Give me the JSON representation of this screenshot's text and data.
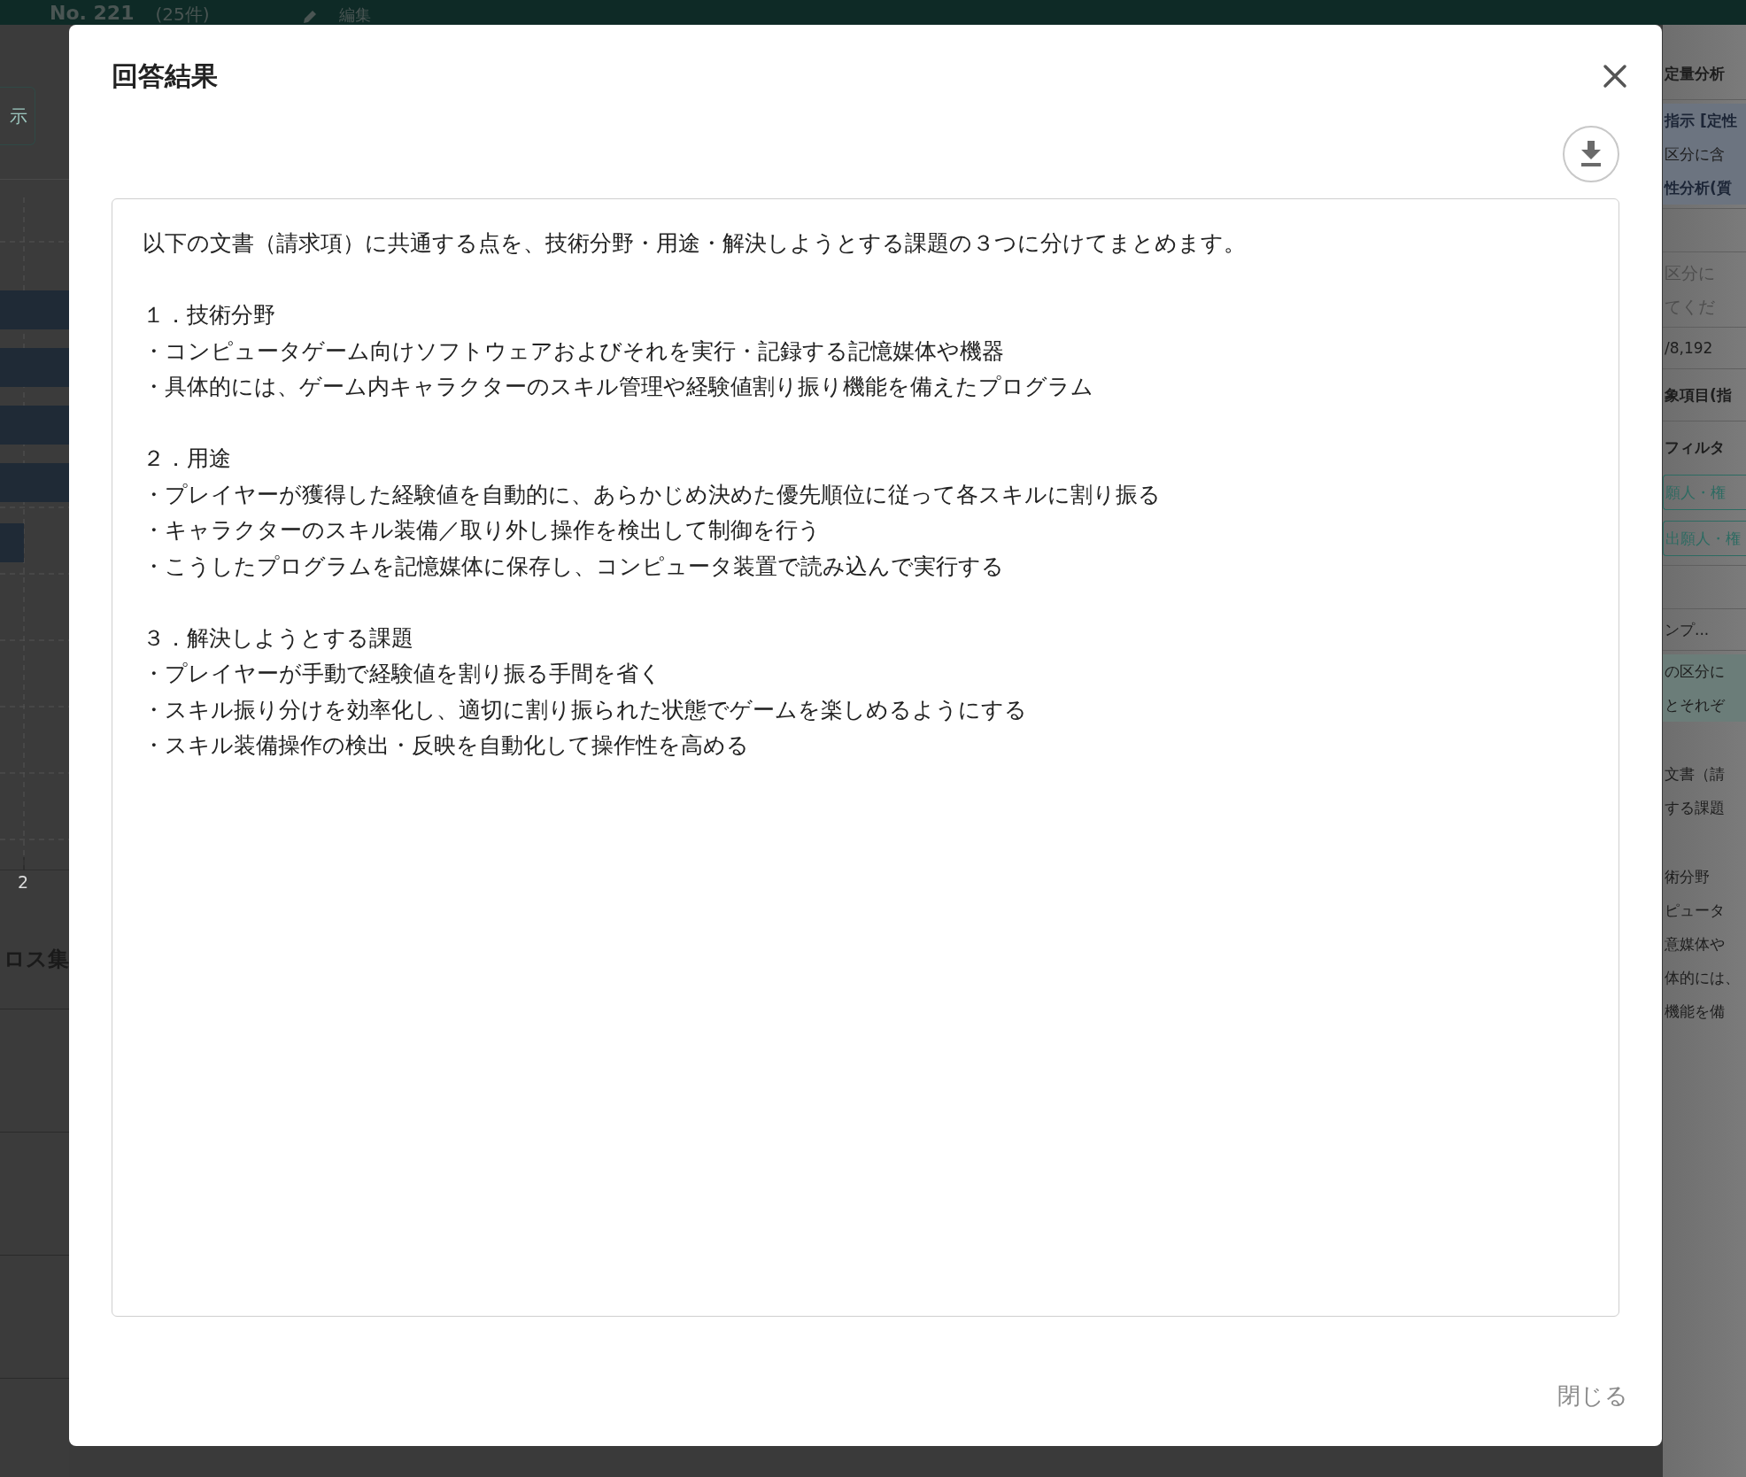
{
  "header": {
    "title": "No. 221",
    "count": "(25件)",
    "edit_label": "編集"
  },
  "left_panel": {
    "button_label": "示",
    "axis_tick": "2",
    "section_title": "ロス集"
  },
  "right_panel": {
    "items": [
      {
        "kind": "heading",
        "text": "定量分析"
      },
      {
        "kind": "rule"
      },
      {
        "kind": "box-heading",
        "text": "指示 [定性"
      },
      {
        "kind": "box-text",
        "text": "区分に含"
      },
      {
        "kind": "box-heading",
        "text": "性分析(質"
      },
      {
        "kind": "rule"
      },
      {
        "kind": "gap"
      },
      {
        "kind": "rule"
      },
      {
        "kind": "muted",
        "text": "区分に"
      },
      {
        "kind": "muted",
        "text": "てくだ"
      },
      {
        "kind": "rule"
      },
      {
        "kind": "text",
        "text": "/8,192"
      },
      {
        "kind": "rule"
      },
      {
        "kind": "heading",
        "text": "象項目(指"
      },
      {
        "kind": "rule"
      },
      {
        "kind": "heading",
        "text": "フィルタ"
      },
      {
        "kind": "tag",
        "text": "願人・権"
      },
      {
        "kind": "tag",
        "text": "出願人・権"
      },
      {
        "kind": "rule"
      },
      {
        "kind": "gap"
      },
      {
        "kind": "rule"
      },
      {
        "kind": "text",
        "text": "ンプ..."
      },
      {
        "kind": "rule"
      },
      {
        "kind": "highlight",
        "text": "の区分に"
      },
      {
        "kind": "highlight",
        "text": "とそれぞ"
      },
      {
        "kind": "gap"
      },
      {
        "kind": "text",
        "text": "文書（請"
      },
      {
        "kind": "text",
        "text": "する課題"
      },
      {
        "kind": "gap"
      },
      {
        "kind": "text",
        "text": "術分野"
      },
      {
        "kind": "text",
        "text": "ピュータ"
      },
      {
        "kind": "text",
        "text": "意媒体や"
      },
      {
        "kind": "text",
        "text": "体的には、"
      },
      {
        "kind": "text",
        "text": "機能を備"
      }
    ]
  },
  "dialog": {
    "title": "回答結果",
    "answer": {
      "intro": "以下の文書（請求項）に共通する点を、技術分野・用途・解決しようとする課題の３つに分けてまとめます。",
      "sections": [
        {
          "heading": "１．技術分野",
          "bullets": [
            "・コンピュータゲーム向けソフトウェアおよびそれを実行・記録する記憶媒体や機器",
            "・具体的には、ゲーム内キャラクターのスキル管理や経験値割り振り機能を備えたプログラム"
          ]
        },
        {
          "heading": "２．用途",
          "bullets": [
            "・プレイヤーが獲得した経験値を自動的に、あらかじめ決めた優先順位に従って各スキルに割り振る",
            "・キャラクターのスキル装備／取り外し操作を検出して制御を行う",
            "・こうしたプログラムを記憶媒体に保存し、コンピュータ装置で読み込んで実行する"
          ]
        },
        {
          "heading": "３．解決しようとする課題",
          "bullets": [
            "・プレイヤーが手動で経験値を割り振る手間を省く",
            "・スキル振り分けを効率化し、適切に割り振られた状態でゲームを楽しめるようにする",
            "・スキル装備操作の検出・反映を自動化して操作性を高める"
          ]
        }
      ]
    },
    "close_label": "閉じる"
  }
}
